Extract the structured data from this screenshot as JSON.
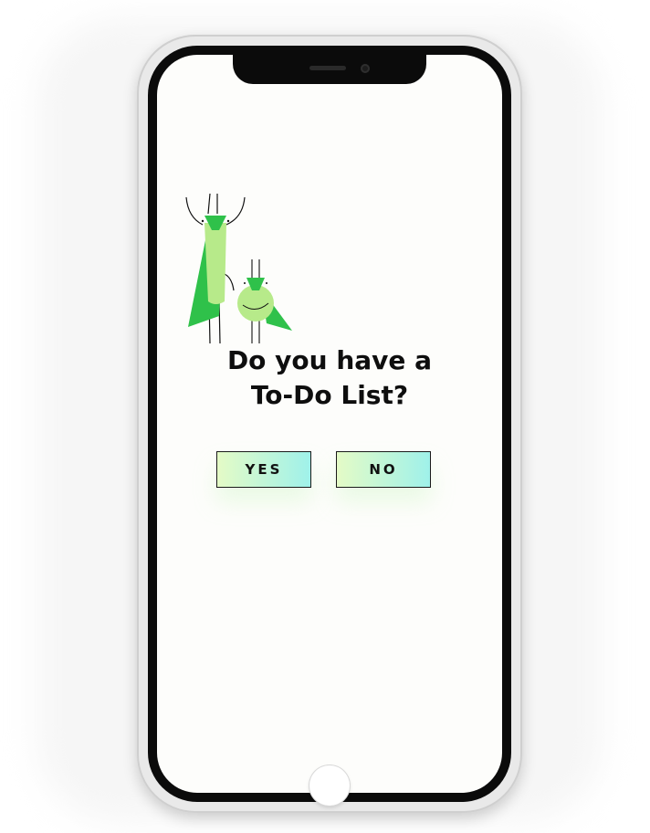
{
  "screen": {
    "question_line1": "Do you have a",
    "question_line2": "To-Do List?",
    "buttons": {
      "yes_label": "YES",
      "no_label": "NO"
    }
  },
  "illustration": {
    "icon": "grasshoppers-illustration"
  },
  "colors": {
    "screen_background": "#fdfdfb",
    "text": "#0e0e0e",
    "button_gradient_start": "#e4fbc6",
    "button_gradient_end": "#9ff1ea",
    "grasshopper_dark_green": "#2fc14a",
    "grasshopper_light_green": "#b7ea8a"
  }
}
